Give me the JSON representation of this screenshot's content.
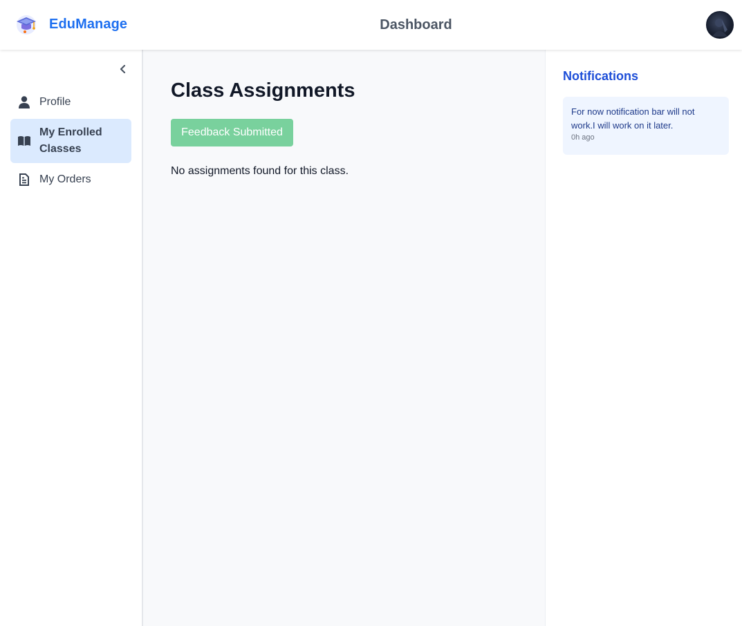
{
  "brand": {
    "name": "EduManage"
  },
  "header": {
    "title": "Dashboard"
  },
  "sidebar": {
    "items": [
      {
        "label": "Profile",
        "icon": "user-icon",
        "active": false
      },
      {
        "label": "My Enrolled Classes",
        "icon": "book-icon",
        "active": true
      },
      {
        "label": "My Orders",
        "icon": "document-icon",
        "active": false
      }
    ]
  },
  "main": {
    "title": "Class Assignments",
    "feedback_button": "Feedback Submitted",
    "empty_message": "No assignments found for this class."
  },
  "notifications": {
    "title": "Notifications",
    "items": [
      {
        "message": "For now notification bar will not work.I will work on it later.",
        "time": "0h ago"
      }
    ]
  },
  "colors": {
    "brand": "#1d6ff0",
    "active_nav_bg": "#dbeafe",
    "button_green": "#79d19d",
    "notification_title": "#1d4ed8",
    "notification_card_bg": "#eff5ff"
  }
}
